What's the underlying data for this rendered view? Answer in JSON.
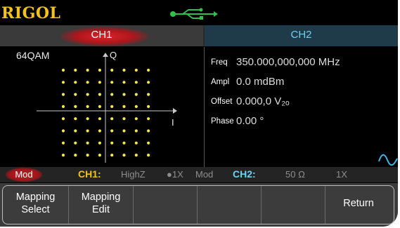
{
  "brand": {
    "logo_text": "RIGOL",
    "usb_icon": "usb-icon",
    "logo_color": "#f1c21b"
  },
  "tabs": {
    "ch1": "CH1",
    "ch2": "CH2",
    "ch1_color": "#d8262a",
    "ch2_color": "#6fd0f0"
  },
  "display": {
    "mod_type": "64QAM",
    "axis_q": "Q",
    "axis_i": "I",
    "constellation_grid": [
      8,
      8
    ],
    "dot_color": "#f5e64a"
  },
  "params": [
    {
      "key": "Freq",
      "value": "350.000,000,000 MHz"
    },
    {
      "key": "Ampl",
      "value": "0.0 mdBm"
    },
    {
      "key": "Offset",
      "value": "0.000,0 V₂ₒ"
    },
    {
      "key": "Phase",
      "value": "0.00 °"
    }
  ],
  "waveform_icon": "sine-wave-icon",
  "status": {
    "mod_button": "Mod",
    "ch1_label": "CH1:",
    "ch1_impedance": "HighZ",
    "ch1_scale": "●1X",
    "ch1_mode": "Mod",
    "ch2_label": "CH2:",
    "ch2_impedance": "50 Ω",
    "ch2_scale": "1X"
  },
  "softkeys": [
    {
      "line1": "Mapping",
      "line2": "Select"
    },
    {
      "line1": "Mapping",
      "line2": "Edit"
    },
    {
      "line1": "",
      "line2": ""
    },
    {
      "line1": "",
      "line2": ""
    },
    {
      "line1": "",
      "line2": ""
    },
    {
      "single": "Return"
    }
  ]
}
